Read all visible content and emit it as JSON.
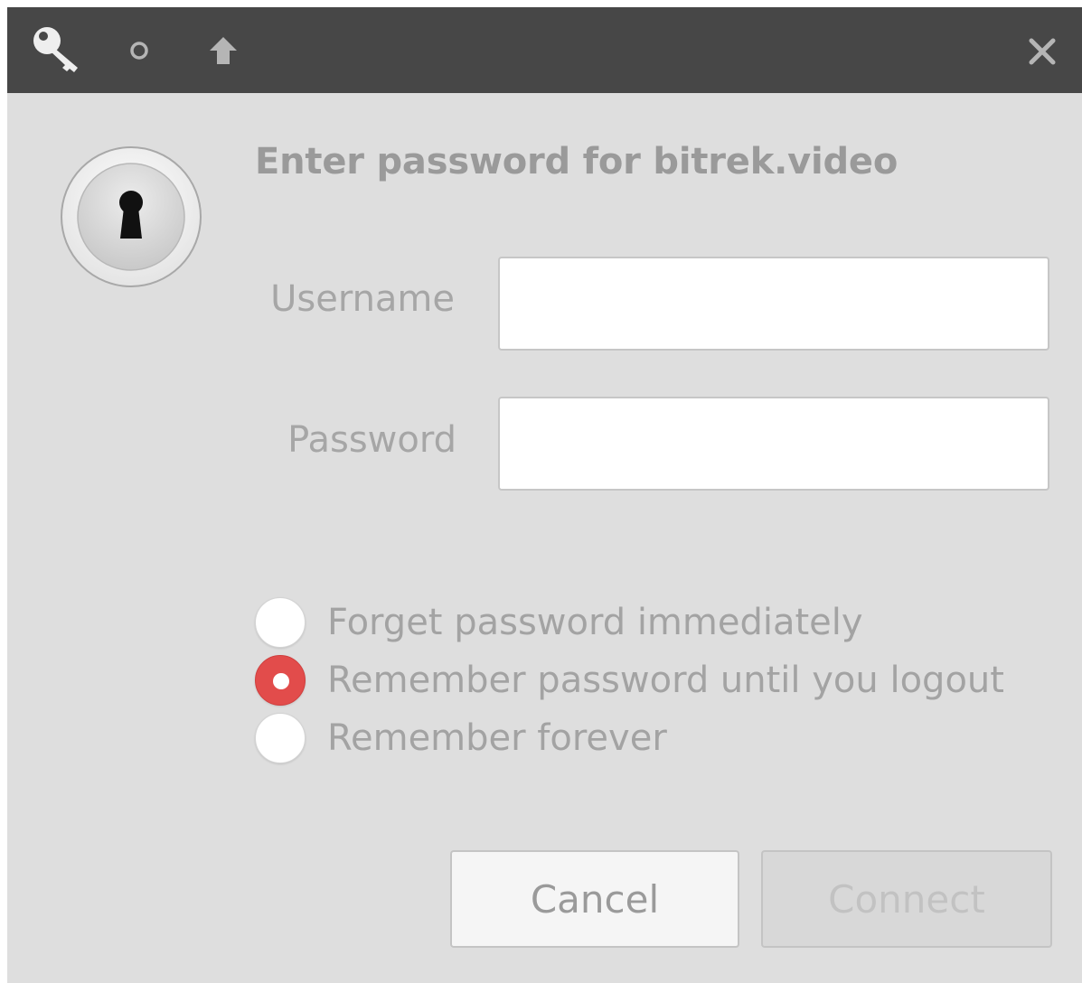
{
  "titlebar": {
    "icons": [
      "key-icon",
      "circle-icon",
      "arrow-up-icon",
      "close-icon"
    ]
  },
  "dialog": {
    "icon": "keyhole-icon",
    "heading": "Enter password for bitrek.video",
    "username": {
      "label": "Username",
      "value": "",
      "placeholder": ""
    },
    "password": {
      "label": "Password",
      "value": "",
      "placeholder": ""
    },
    "remember_options": [
      {
        "label": "Forget password immediately",
        "selected": false
      },
      {
        "label": "Remember password until you logout",
        "selected": true
      },
      {
        "label": "Remember forever",
        "selected": false
      }
    ],
    "buttons": {
      "cancel": "Cancel",
      "connect": "Connect"
    }
  },
  "colors": {
    "titlebar": "#474747",
    "background": "#dedede",
    "accent": "#e24c4b",
    "text": "#a3a3a3"
  }
}
